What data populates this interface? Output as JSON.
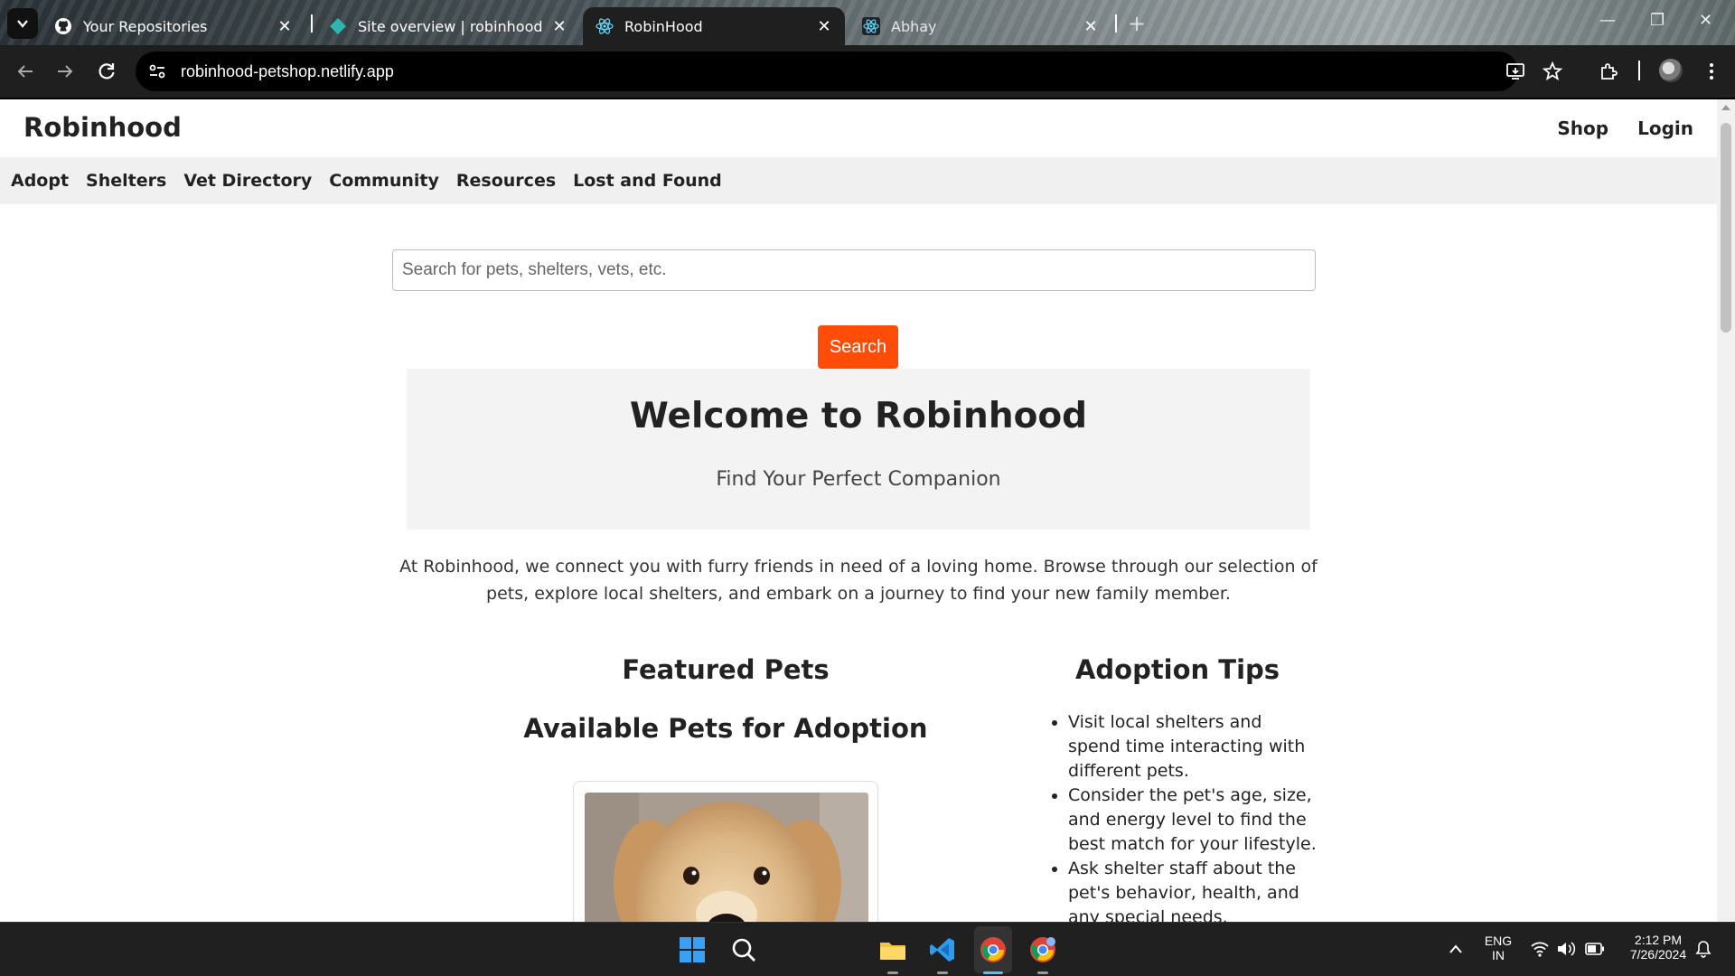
{
  "browser": {
    "tabs": [
      {
        "title": "Your Repositories",
        "icon": "github-icon"
      },
      {
        "title": "Site overview | robinhood-pet",
        "icon": "netlify-icon"
      },
      {
        "title": "RobinHood",
        "icon": "react-icon",
        "active": true
      },
      {
        "title": "Abhay",
        "icon": "react-icon"
      }
    ],
    "url": "robinhood-petshop.netlify.app",
    "accent": "#1f1f1f"
  },
  "site": {
    "brand": "Robinhood",
    "header_links": [
      "Shop",
      "Login"
    ],
    "nav": [
      "Adopt",
      "Shelters",
      "Vet Directory",
      "Community",
      "Resources",
      "Lost and Found"
    ],
    "search": {
      "placeholder": "Search for pets, shelters, vets, etc.",
      "button": "Search",
      "button_color": "#ff4d08"
    },
    "hero": {
      "title": "Welcome to Robinhood",
      "subtitle": "Find Your Perfect Companion"
    },
    "intro": "At Robinhood, we connect you with furry friends in need of a loving home. Browse through our selection of pets, explore local shelters, and embark on a journey to find your new family member.",
    "featured_title": "Featured Pets",
    "available_title": "Available Pets for Adoption",
    "tips_title": "Adoption Tips",
    "tips": [
      "Visit local shelters and spend time interacting with different pets.",
      "Consider the pet's age, size, and energy level to find the best match for your lifestyle.",
      "Ask shelter staff about the pet's behavior, health, and any special needs."
    ]
  },
  "taskbar": {
    "language": "ENG",
    "region": "IN",
    "time": "2:12 PM",
    "date": "7/26/2024",
    "pinned": [
      "windows-start-icon",
      "search-icon",
      "file-explorer-icon",
      "vscode-icon",
      "chrome-icon",
      "chrome-profile-icon"
    ]
  }
}
